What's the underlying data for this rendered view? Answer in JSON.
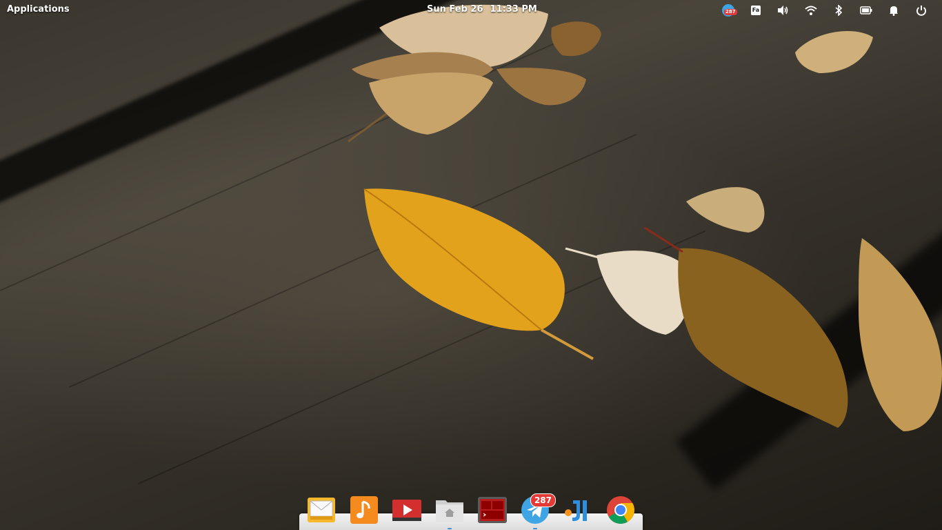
{
  "top_panel": {
    "applications_label": "Applications",
    "clock": {
      "date": "Sun Feb 26",
      "time": "11:33 PM"
    },
    "indicators": {
      "telegram_count": "287",
      "keyboard_layout": "Fa"
    }
  },
  "dock": {
    "items": [
      {
        "name": "Mail",
        "icon": "mail-icon",
        "running": false
      },
      {
        "name": "Music",
        "icon": "music-icon",
        "running": false
      },
      {
        "name": "Videos",
        "icon": "videos-icon",
        "running": false
      },
      {
        "name": "Files",
        "icon": "folder-home-icon",
        "running": true
      },
      {
        "name": "Terminal",
        "icon": "terminal-icon",
        "running": false
      },
      {
        "name": "Telegram",
        "icon": "telegram-icon",
        "running": true,
        "badge": "287"
      },
      {
        "name": "JetBrains IDE",
        "icon": "jetbrains-icon",
        "running": false
      },
      {
        "name": "Google Chrome",
        "icon": "chrome-icon",
        "running": false
      }
    ]
  },
  "colors": {
    "panel_text": "#ffffff",
    "dock_bg": "#e8e8e8",
    "badge_red": "#e53935",
    "running_indicator": "#3f8fd8",
    "telegram_blue": "#3ea4e3"
  }
}
